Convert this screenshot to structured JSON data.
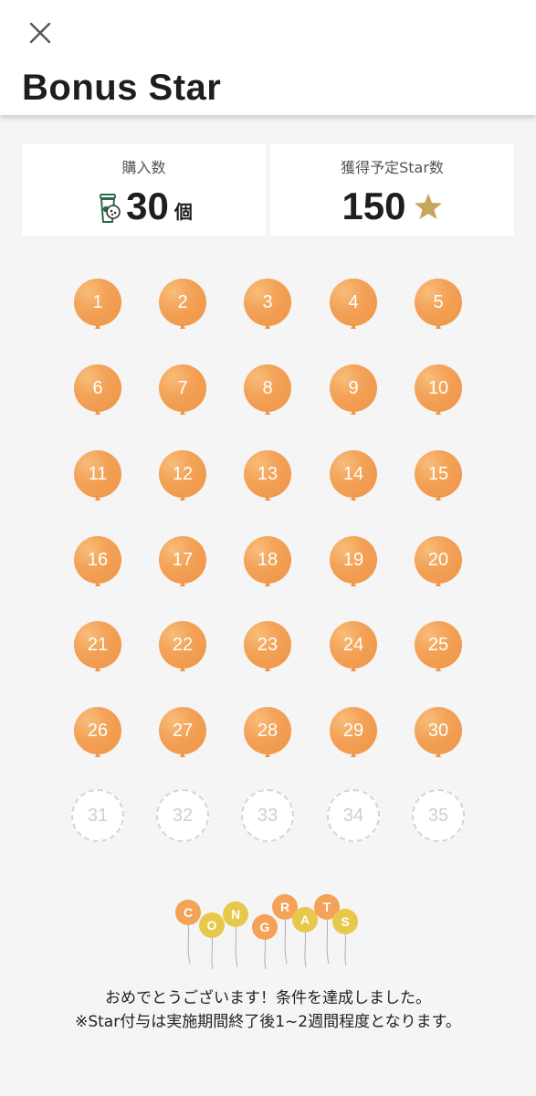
{
  "header": {
    "title": "Bonus Star",
    "close_icon": "close-icon"
  },
  "stats": {
    "purchase_label": "購入数",
    "purchase_count": "30",
    "purchase_unit": "個",
    "purchase_icon": "drink-cup-icon",
    "stars_label": "獲得予定Star数",
    "stars_count": "150",
    "stars_icon": "star-icon"
  },
  "colors": {
    "balloon": "#f3a257",
    "star": "#c9a55b",
    "empty_slot_border": "#d5d5d5"
  },
  "balloons": {
    "filled_count": 30,
    "total_slots": 35,
    "numbers": [
      "1",
      "2",
      "3",
      "4",
      "5",
      "6",
      "7",
      "8",
      "9",
      "10",
      "11",
      "12",
      "13",
      "14",
      "15",
      "16",
      "17",
      "18",
      "19",
      "20",
      "21",
      "22",
      "23",
      "24",
      "25",
      "26",
      "27",
      "28",
      "29",
      "30",
      "31",
      "32",
      "33",
      "34",
      "35"
    ]
  },
  "congrats": {
    "letters": [
      "C",
      "O",
      "N",
      "G",
      "R",
      "A",
      "T",
      "S"
    ]
  },
  "message": {
    "line1": "おめでとうございます！条件を達成しました。",
    "line2": "※Star付与は実施期間終了後1~2週間程度となります。"
  }
}
